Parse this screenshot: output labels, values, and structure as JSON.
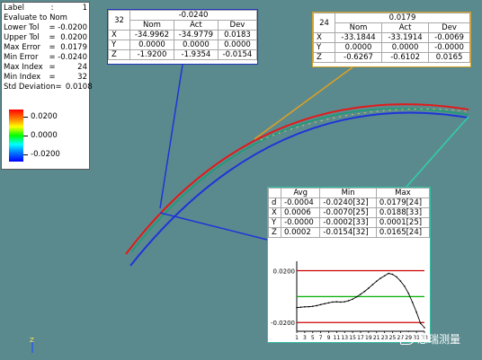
{
  "stats": {
    "rows": [
      {
        "key": "Label",
        "sep": ":",
        "value": "1"
      },
      {
        "full": "Evaluate to Nom"
      },
      {
        "key": "Lower Tol",
        "sep": "=",
        "value": "-0.0200"
      },
      {
        "key": "Upper Tol",
        "sep": "=",
        "value": "0.0200"
      },
      {
        "key": "Max Error",
        "sep": "=",
        "value": "0.0179"
      },
      {
        "key": "Min Error",
        "sep": "=",
        "value": "-0.0240"
      },
      {
        "key": "Max Index",
        "sep": "=",
        "value": "24"
      },
      {
        "key": "Min Index",
        "sep": "=",
        "value": "32"
      },
      {
        "key": "Std Deviation",
        "sep": "=",
        "value": "0.0108"
      }
    ],
    "legend": {
      "top": "0.0200",
      "mid": "0.0000",
      "bottom": "-0.0200"
    }
  },
  "point32": {
    "index": "32",
    "dev": "-0.0240",
    "headers": [
      "Nom",
      "Act",
      "Dev"
    ],
    "rows": [
      {
        "axis": "X",
        "nom": "-34.9962",
        "act": "-34.9779",
        "dev": "0.0183"
      },
      {
        "axis": "Y",
        "nom": "0.0000",
        "act": "0.0000",
        "dev": "0.0000"
      },
      {
        "axis": "Z",
        "nom": "-1.9200",
        "act": "-1.9354",
        "dev": "-0.0154"
      }
    ]
  },
  "point24": {
    "index": "24",
    "dev": "0.0179",
    "headers": [
      "Nom",
      "Act",
      "Dev"
    ],
    "rows": [
      {
        "axis": "X",
        "nom": "-33.1844",
        "act": "-33.1914",
        "dev": "-0.0069"
      },
      {
        "axis": "Y",
        "nom": "0.0000",
        "act": "0.0000",
        "dev": "-0.0000"
      },
      {
        "axis": "Z",
        "nom": "-0.6267",
        "act": "-0.6102",
        "dev": "0.0165"
      }
    ]
  },
  "summary": {
    "headers": [
      "Avg",
      "Min",
      "Max"
    ],
    "rows": [
      {
        "axis": "d",
        "avg": "-0.0004",
        "min": "-0.0240[32]",
        "max": "0.0179[24]"
      },
      {
        "axis": "X",
        "avg": "0.0006",
        "min": "-0.0070[25]",
        "max": "0.0188[33]"
      },
      {
        "axis": "Y",
        "avg": "-0.0000",
        "min": "-0.0002[33]",
        "max": "0.0001[25]"
      },
      {
        "axis": "Z",
        "avg": "0.0002",
        "min": "-0.0154[32]",
        "max": "0.0165[24]"
      }
    ]
  },
  "chart_data": {
    "type": "line",
    "y_labels": [
      "0.0200",
      "-0.0200"
    ],
    "x": [
      1,
      2,
      3,
      4,
      5,
      6,
      7,
      8,
      9,
      10,
      11,
      12,
      13,
      14,
      15,
      16,
      17,
      18,
      19,
      20,
      21,
      22,
      23,
      24,
      25,
      26,
      27,
      28,
      29,
      30,
      31,
      32,
      33
    ],
    "x_ticks": [
      "1",
      "3",
      "5",
      "7",
      "9",
      "11",
      "13",
      "15",
      "17",
      "19",
      "21",
      "23",
      "25",
      "27",
      "29",
      "31",
      "33"
    ],
    "reference_lines": [
      0.02,
      0.0,
      -0.02
    ],
    "reference_colors": [
      "#cc0000",
      "#00b000",
      "#cc0000"
    ],
    "values": [
      -0.0085,
      -0.0082,
      -0.0079,
      -0.0078,
      -0.0075,
      -0.007,
      -0.0062,
      -0.0055,
      -0.0048,
      -0.0042,
      -0.004,
      -0.0042,
      -0.004,
      -0.0032,
      -0.002,
      -0.0002,
      0.0018,
      0.004,
      0.0065,
      0.0092,
      0.0118,
      0.0142,
      0.016,
      0.0179,
      0.0172,
      0.0152,
      0.012,
      0.008,
      0.0025,
      -0.0045,
      -0.012,
      -0.0205,
      -0.024
    ],
    "ylim": [
      -0.024,
      0.0245
    ]
  },
  "colors": {
    "background": "#5b8a8e",
    "nominal_curve": "#1d35d8",
    "actual_curve": "#e21a1a",
    "tolerance_curve": "#10a070",
    "leader_blue": "#1d35d8",
    "leader_orange": "#e0a020",
    "leader_teal": "#30d0a8"
  },
  "icons": {
    "triad": "axis-triad-icon",
    "wechat": "wechat-logo-icon"
  },
  "watermark": {
    "text": "思瑞测量"
  },
  "triad": {
    "label": "Z"
  }
}
